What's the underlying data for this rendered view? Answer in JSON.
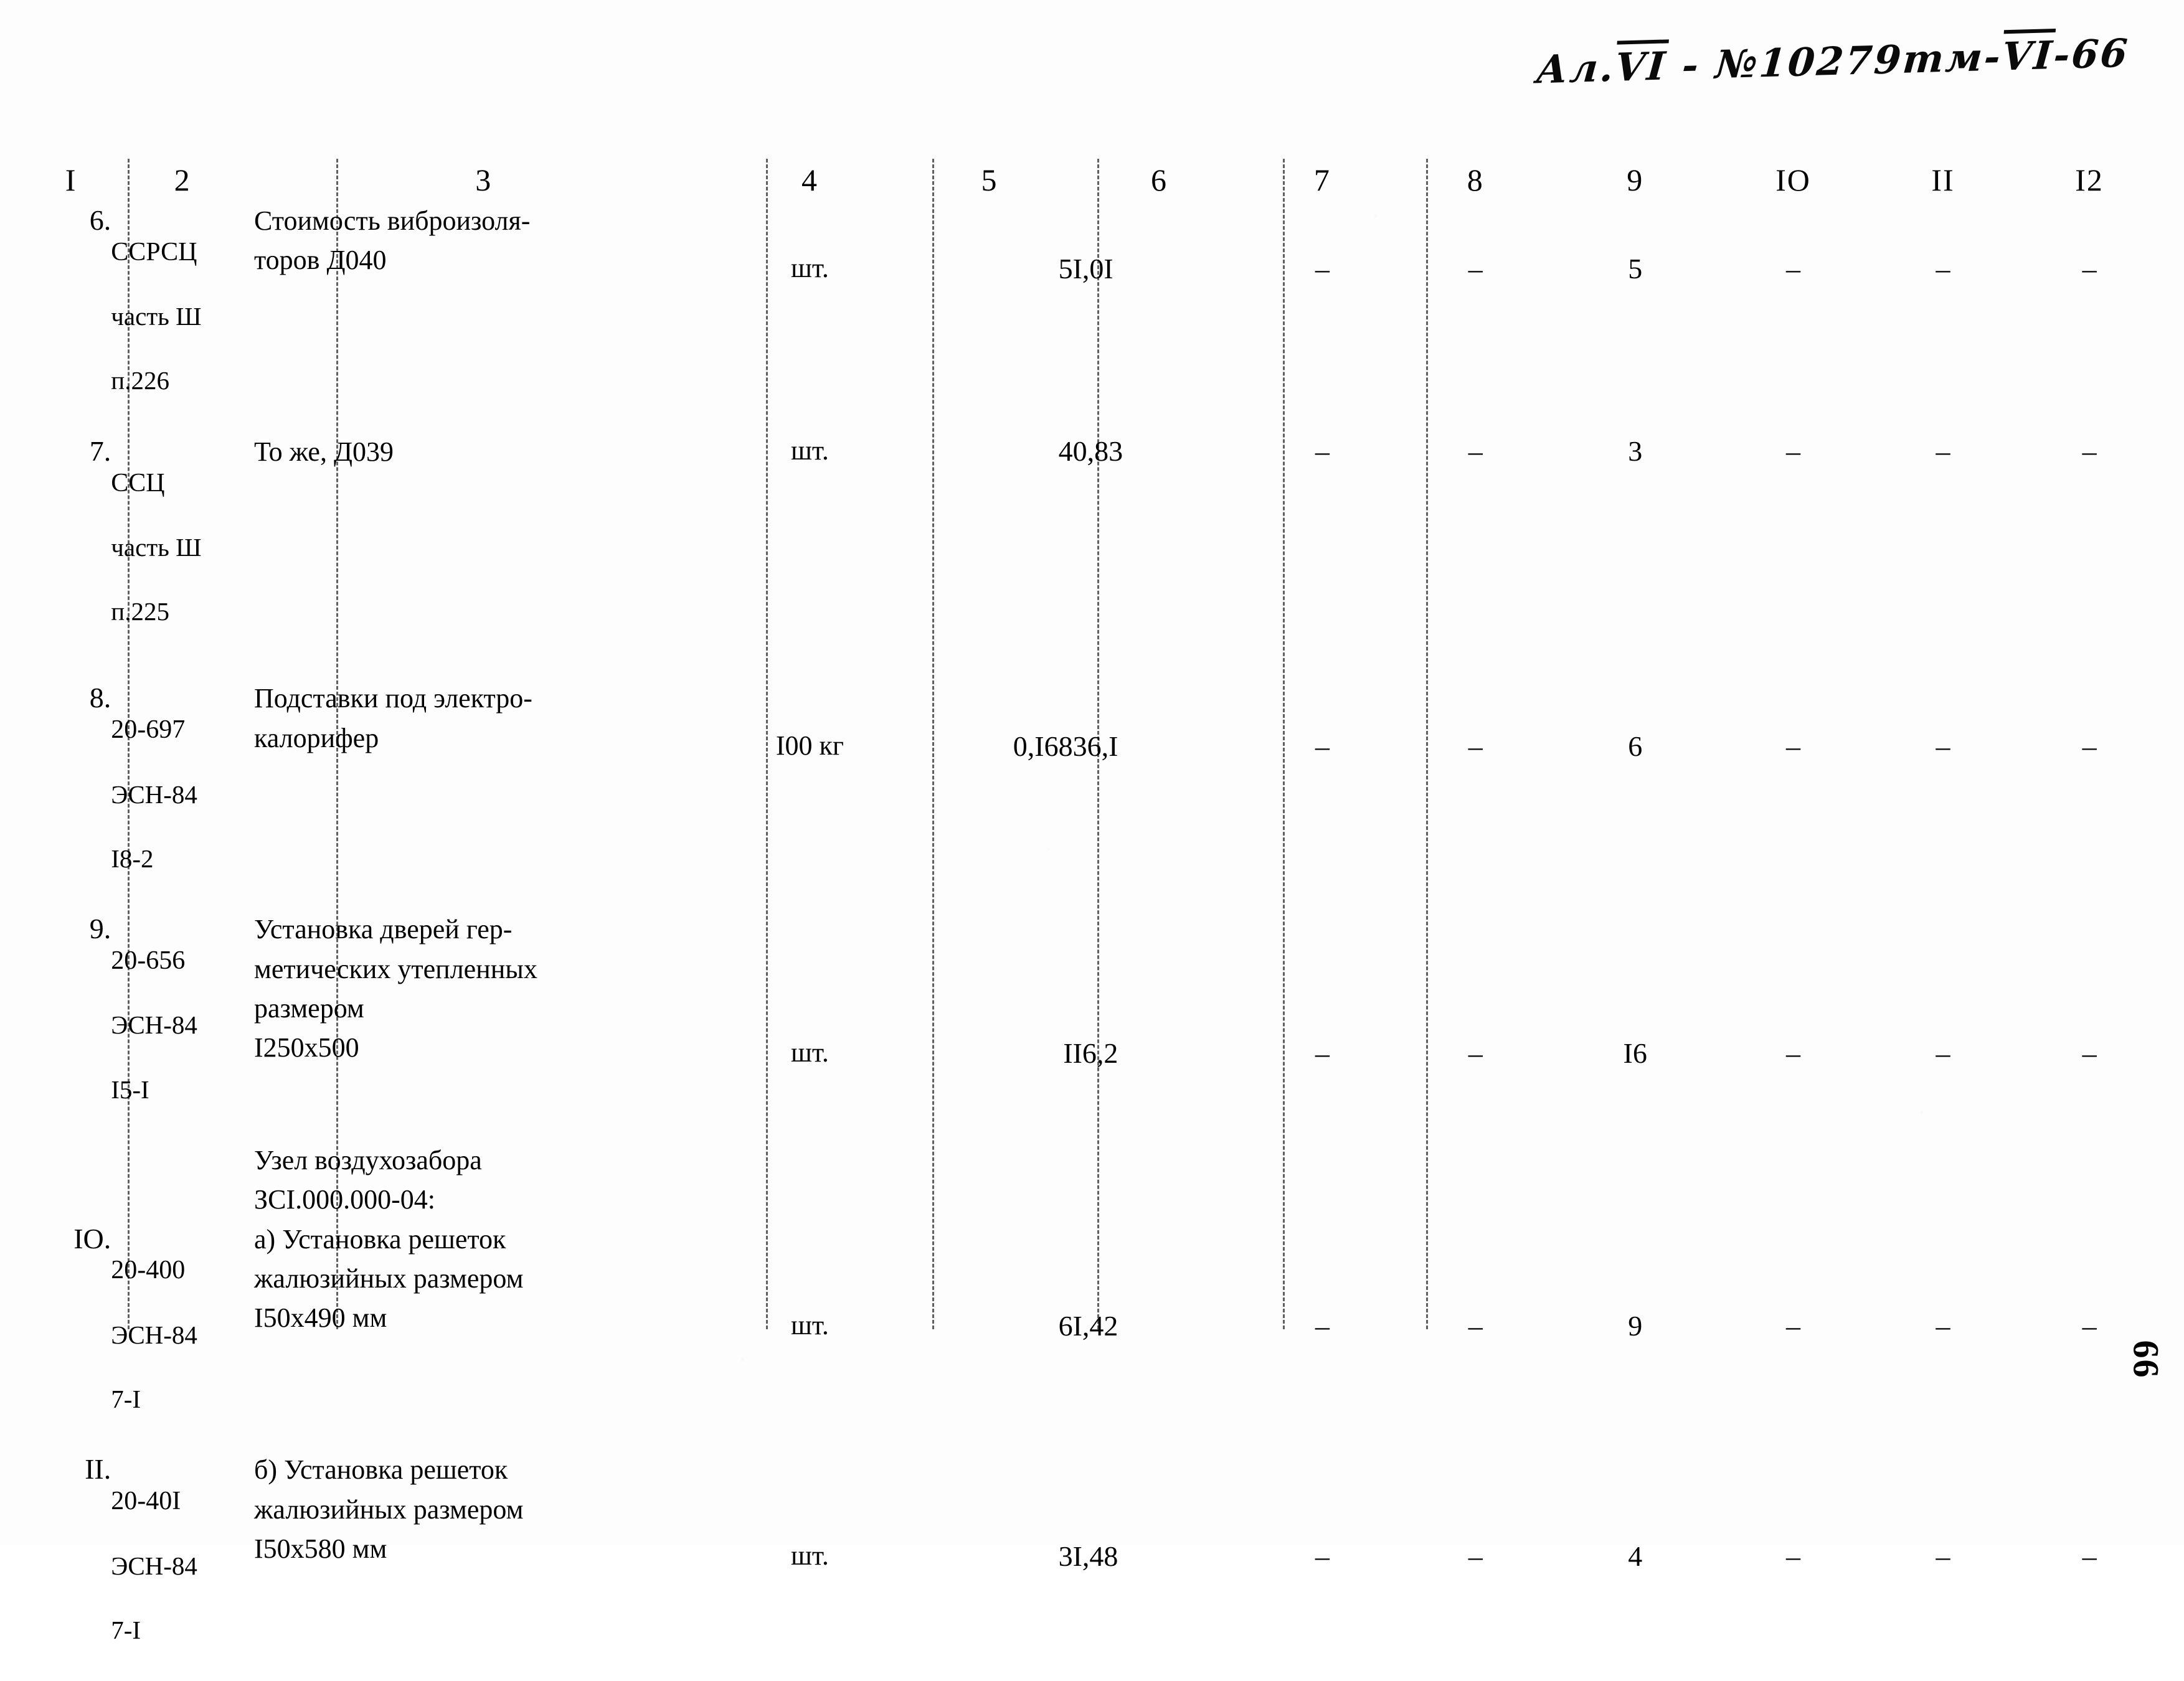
{
  "header": {
    "handwritten_note_parts": [
      "Ал.",
      "VI",
      " - №10279тм-",
      "VI",
      "-66"
    ],
    "handwritten_note": "Ал.VI - №10279тм-VI-66"
  },
  "page_number": "66",
  "table": {
    "column_headers": [
      "I",
      "2",
      "3",
      "4",
      "5",
      "6",
      "7",
      "8",
      "9",
      "IO",
      "II",
      "I2"
    ],
    "rows": [
      {
        "num": "6.",
        "code_l1": "ССРСЦ",
        "code_l2": "часть Ш",
        "code_l3": "п.226",
        "desc_l1": "Стоимость виброизоля-",
        "desc_l2": "торов Д040",
        "desc_l3": "",
        "desc_l4": "",
        "unit": "шт.",
        "qty": "5",
        "price": "I,0I",
        "c7": "–",
        "c8": "–",
        "c9": "5",
        "c10": "–",
        "c11": "–",
        "c12": "–"
      },
      {
        "num": "7.",
        "code_l1": "ССЦ",
        "code_l2": "часть Ш",
        "code_l3": "п.225",
        "desc_l1": "То же, Д039",
        "desc_l2": "",
        "desc_l3": "",
        "desc_l4": "",
        "unit": "шт.",
        "qty": "4",
        "price": "0,83",
        "c7": "–",
        "c8": "–",
        "c9": "3",
        "c10": "–",
        "c11": "–",
        "c12": "–"
      },
      {
        "num": "8.",
        "code_l1": "20-697",
        "code_l2": "ЭСН-84",
        "code_l3": "I8-2",
        "desc_l1": "Подставки под электро-",
        "desc_l2": "калорифер",
        "desc_l3": "",
        "desc_l4": "",
        "unit": "I00 кг",
        "qty": "0,I68",
        "price": "36,I",
        "c7": "–",
        "c8": "–",
        "c9": "6",
        "c10": "–",
        "c11": "–",
        "c12": "–"
      },
      {
        "num": "9.",
        "code_l1": "20-656",
        "code_l2": "ЭСН-84",
        "code_l3": "I5-I",
        "desc_l1": "Установка дверей гер-",
        "desc_l2": "метических утепленных",
        "desc_l3": "размером",
        "desc_l4": "I250x500",
        "unit": "шт.",
        "qty": "I",
        "price": "I6,2",
        "c7": "–",
        "c8": "–",
        "c9": "I6",
        "c10": "–",
        "c11": "–",
        "c12": "–"
      },
      {
        "num": "",
        "code_l1": "",
        "code_l2": "",
        "code_l3": "",
        "desc_l1": "Узел воздухозабора",
        "desc_l2": "ЗСI.000.000-04:",
        "desc_l3": "",
        "desc_l4": "",
        "unit": "",
        "qty": "",
        "price": "",
        "c7": "",
        "c8": "",
        "c9": "",
        "c10": "",
        "c11": "",
        "c12": ""
      },
      {
        "num": "IO.",
        "code_l1": "20-400",
        "code_l2": "ЭСН-84",
        "code_l3": "7-I",
        "desc_l1": "а) Установка решеток",
        "desc_l2": "жалюзийных размером",
        "desc_l3": "I50x490 мм",
        "desc_l4": "",
        "unit": "шт.",
        "qty": "6",
        "price": "I,42",
        "c7": "–",
        "c8": "–",
        "c9": "9",
        "c10": "–",
        "c11": "–",
        "c12": "–"
      },
      {
        "num": "II.",
        "code_l1": "20-40I",
        "code_l2": "ЭСН-84",
        "code_l3": "7-I",
        "desc_l1": "б) Установка решеток",
        "desc_l2": "жалюзийных размером",
        "desc_l3": "I50x580 мм",
        "desc_l4": "",
        "unit": "шт.",
        "qty": "3",
        "price": "I,48",
        "c7": "–",
        "c8": "–",
        "c9": "4",
        "c10": "–",
        "c11": "–",
        "c12": "–"
      }
    ]
  },
  "colors": {
    "ink": "#000000",
    "paper": "#fdfdfd",
    "rule": "rgba(0,0,0,0.62)"
  }
}
